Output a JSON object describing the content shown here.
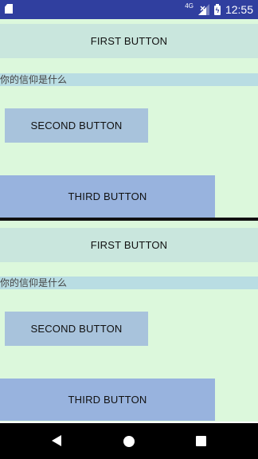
{
  "status_bar": {
    "time": "12:55",
    "network": "4G",
    "icons": [
      "sd-card-icon",
      "signal-icon",
      "battery-icon"
    ]
  },
  "panels": [
    {
      "first_button": "FIRST BUTTON",
      "question": "你的信仰是什么",
      "second_button": "SECOND BUTTON",
      "third_button": "THIRD BUTTON"
    },
    {
      "first_button": "FIRST BUTTON",
      "question": "你的信仰是什么",
      "second_button": "SECOND BUTTON",
      "third_button": "THIRD BUTTON"
    }
  ],
  "nav_bar": {
    "icons": [
      "back-icon",
      "home-icon",
      "recents-icon"
    ]
  },
  "colors": {
    "status_bar": "#303f9f",
    "panel_background": "#dcf8dc",
    "first_button": "#c9e6dd",
    "question_background": "#b9dde3",
    "second_button": "#a8c3dc",
    "third_button": "#98b3de"
  }
}
